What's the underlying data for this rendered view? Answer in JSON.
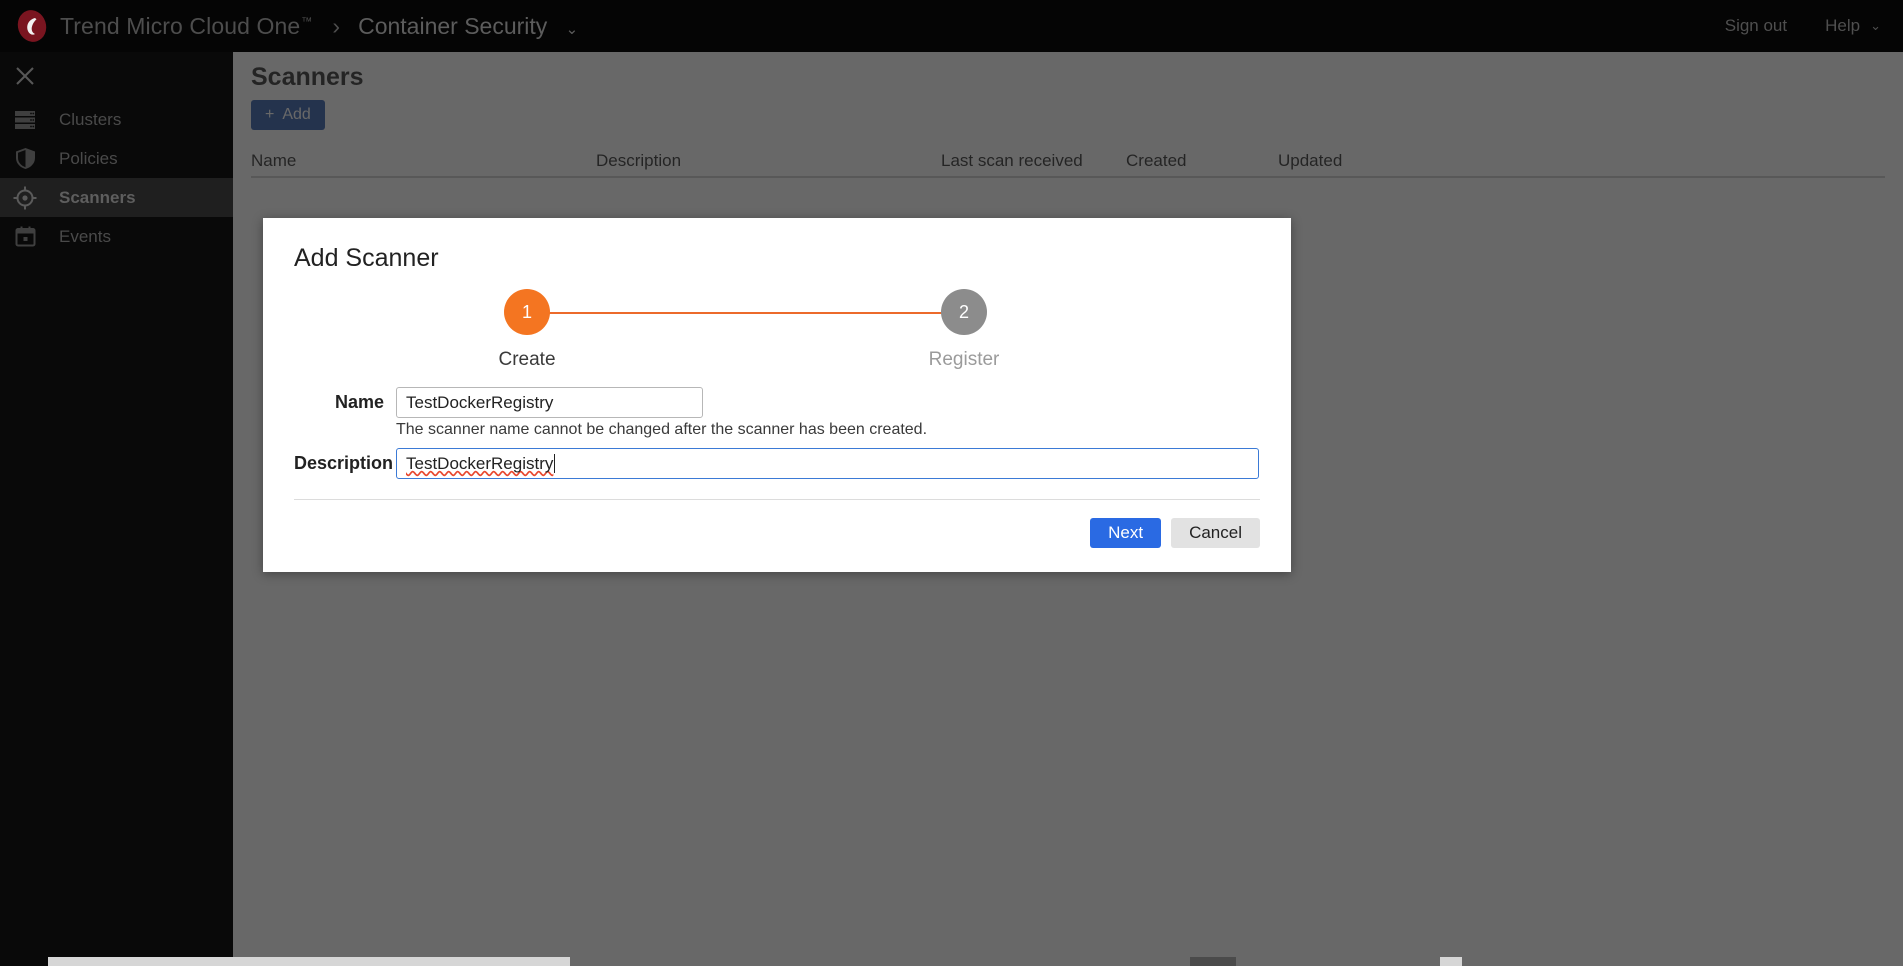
{
  "topbar": {
    "logo_icon": "trend-micro-logo-icon",
    "brand": "Trend Micro Cloud One",
    "brand_tm": "™",
    "breadcrumb_separator": "›",
    "app_name": "Container Security",
    "app_caret_icon": "chevron-down-icon",
    "sign_out": "Sign out",
    "help": "Help",
    "help_caret_icon": "chevron-down-icon"
  },
  "sidebar": {
    "close_icon": "close-icon",
    "items": [
      {
        "label": "Clusters",
        "icon": "server-stack-icon",
        "active": false
      },
      {
        "label": "Policies",
        "icon": "shield-icon",
        "active": false
      },
      {
        "label": "Scanners",
        "icon": "target-crosshair-icon",
        "active": true
      },
      {
        "label": "Events",
        "icon": "calendar-icon",
        "active": false
      }
    ]
  },
  "main": {
    "page_title": "Scanners",
    "add_button": "Add",
    "add_icon": "plus-icon",
    "table": {
      "columns": [
        "Name",
        "Description",
        "Last scan received",
        "Created",
        "Updated"
      ],
      "rows": []
    }
  },
  "modal": {
    "title": "Add Scanner",
    "steps": [
      {
        "number": "1",
        "label": "Create",
        "state": "active"
      },
      {
        "number": "2",
        "label": "Register",
        "state": "inactive"
      }
    ],
    "fields": {
      "name": {
        "label": "Name",
        "value": "TestDockerRegistry",
        "placeholder": "",
        "helper": "The scanner name cannot be changed after the scanner has been created."
      },
      "description": {
        "label": "Description",
        "value": "TestDockerRegistry",
        "placeholder": "",
        "focused": true,
        "spellcheck_flagged": true
      }
    },
    "actions": {
      "next": "Next",
      "cancel": "Cancel"
    }
  },
  "colors": {
    "topbar_bg": "#050505",
    "sidebar_bg": "#090909",
    "sidebar_active_bg": "#1f1f1f",
    "add_button_bg": "#1b4da3",
    "step_active": "#f47521",
    "step_inactive": "#8c8c8c",
    "next_button_bg": "#2a6ae3",
    "cancel_button_bg": "#e2e2e2",
    "focus_border": "#3b7ad6",
    "spellcheck_underline": "#e8482f"
  }
}
